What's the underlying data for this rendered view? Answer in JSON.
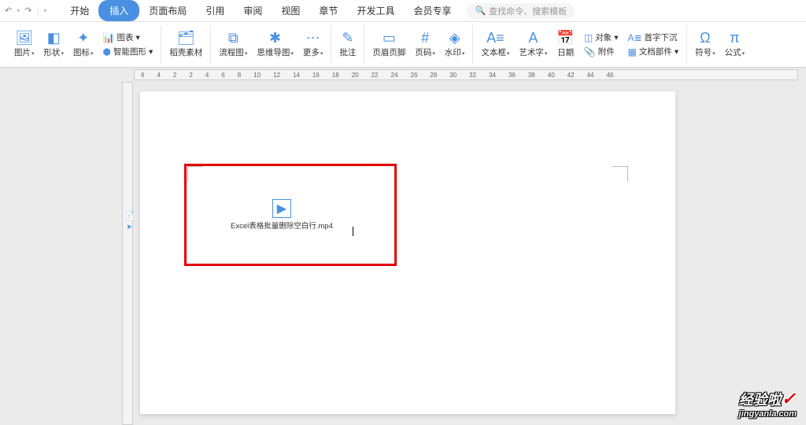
{
  "topbar": {
    "undo": "↶",
    "redo": "↷"
  },
  "tabs": [
    "开始",
    "插入",
    "页面布局",
    "引用",
    "审阅",
    "视图",
    "章节",
    "开发工具",
    "会员专享"
  ],
  "active_tab_index": 1,
  "search": {
    "icon": "🔍",
    "placeholder": "查找命令、搜索模板"
  },
  "ribbon": {
    "g1": [
      {
        "label": "图片",
        "icon": "🖼"
      },
      {
        "label": "形状",
        "icon": "◧"
      },
      {
        "label": "图标",
        "icon": "✦"
      }
    ],
    "g1b": [
      {
        "label": "图表",
        "icon": "📊"
      },
      {
        "label": "智能图形",
        "icon": "⬢"
      }
    ],
    "g2": {
      "label": "稻壳素材",
      "icon": "🗂"
    },
    "g3": [
      {
        "label": "流程图",
        "icon": "⧉"
      },
      {
        "label": "思维导图",
        "icon": "✱"
      },
      {
        "label": "更多",
        "icon": ""
      }
    ],
    "g4": {
      "label": "批注",
      "icon": "✎"
    },
    "g5": [
      {
        "label": "页眉页脚",
        "icon": "▭"
      },
      {
        "label": "页码",
        "icon": "#"
      },
      {
        "label": "水印",
        "icon": "◈"
      }
    ],
    "g6": [
      {
        "label": "文本框",
        "icon": "A≡"
      },
      {
        "label": "艺术字",
        "icon": "A"
      },
      {
        "label": "日期",
        "icon": "📅"
      }
    ],
    "g6b": [
      {
        "label": "对象",
        "icon": "◫"
      },
      {
        "label": "附件",
        "icon": "📎"
      },
      {
        "label": "首字下沉",
        "icon": "A≣"
      },
      {
        "label": "文档部件",
        "icon": "▦"
      }
    ],
    "g7": [
      {
        "label": "符号",
        "icon": "Ω"
      },
      {
        "label": "公式",
        "icon": "π"
      }
    ]
  },
  "ruler_marks": [
    "6",
    "4",
    "2",
    "",
    "2",
    "4",
    "6",
    "8",
    "10",
    "12",
    "14",
    "16",
    "18",
    "20",
    "22",
    "24",
    "26",
    "28",
    "30",
    "32",
    "34",
    "36",
    "38",
    "40",
    "42",
    "44",
    "46"
  ],
  "attachment": {
    "filename": "Excel表格批量删除空白行.mp4"
  },
  "page_icon": "📄",
  "watermark": {
    "line1": "经验啦",
    "line2": "jingyanla.com"
  }
}
